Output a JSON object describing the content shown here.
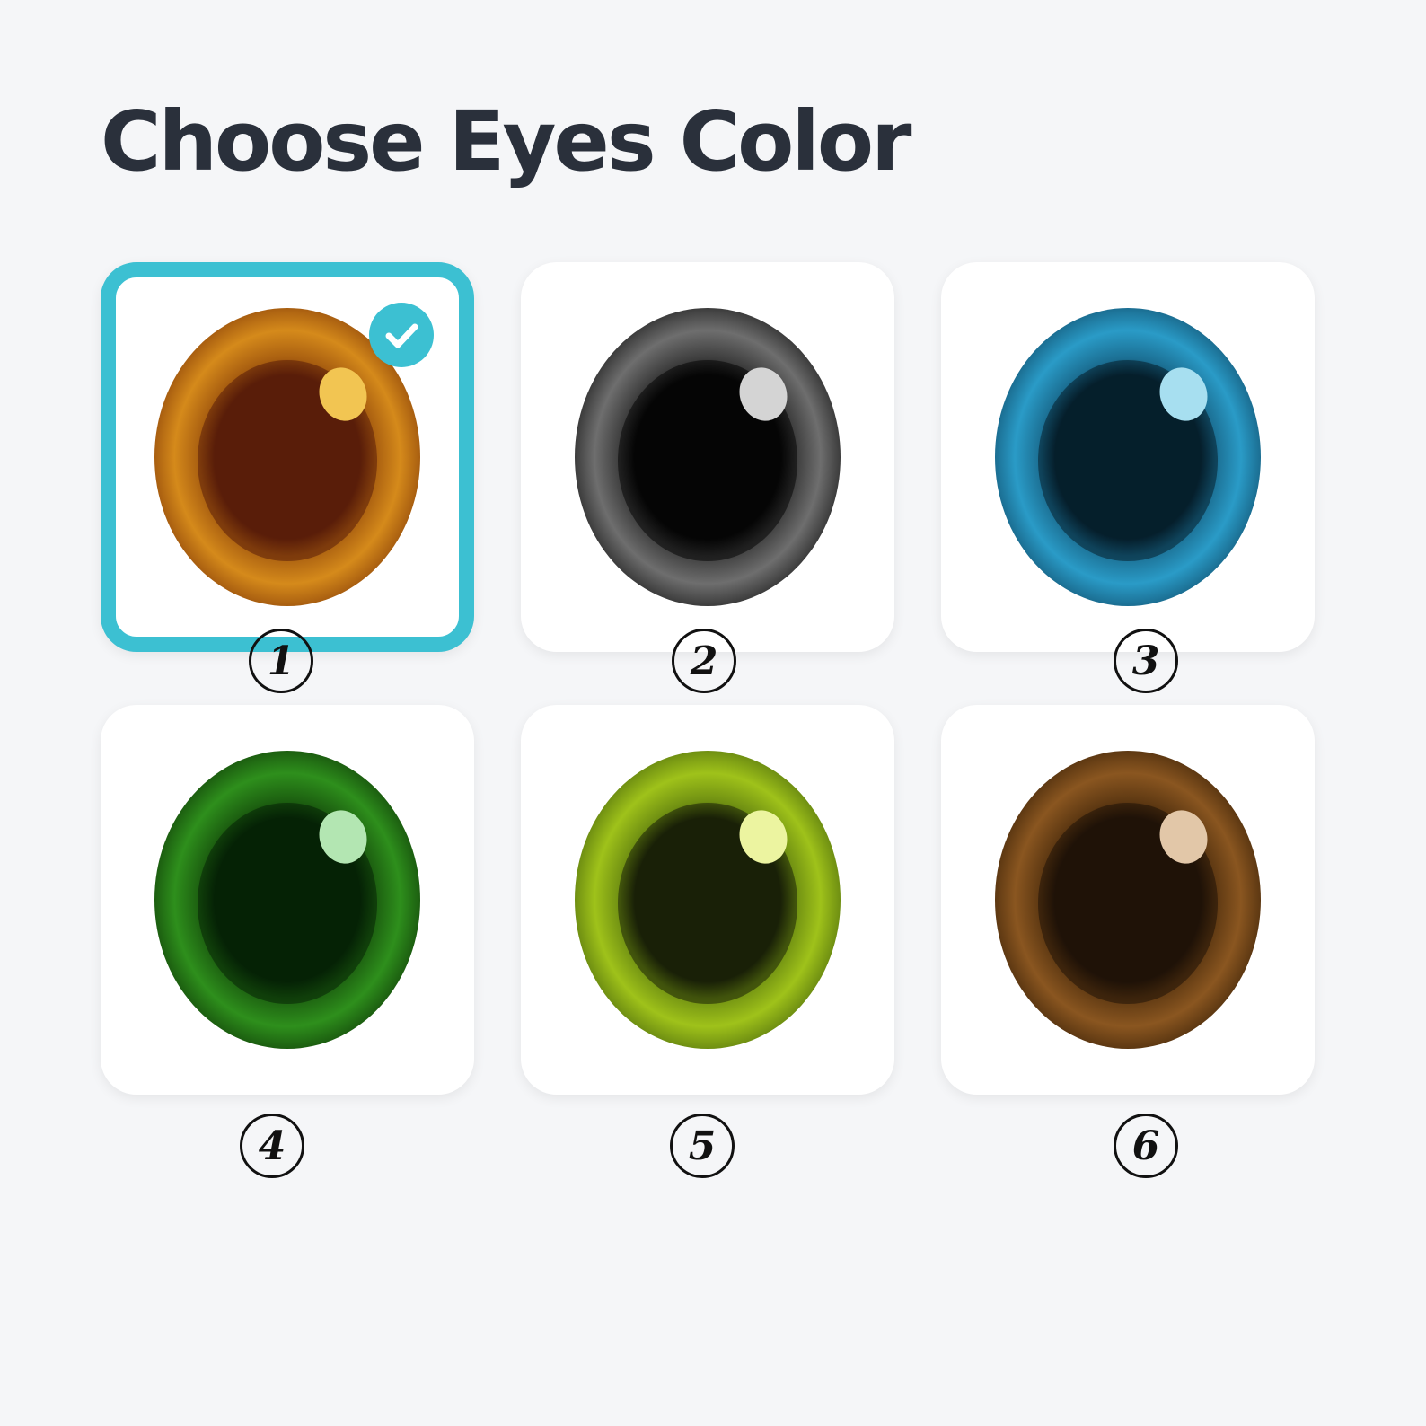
{
  "page": {
    "title": "Choose Eyes Color"
  },
  "options": [
    {
      "number": "1",
      "name": "amber-brown",
      "iris": "#d58a1b",
      "iris_dark": "#a85e10",
      "pupil": "#5a1e0a",
      "highlight": "#f2c552",
      "selected": true
    },
    {
      "number": "2",
      "name": "gray",
      "iris": "#6e6e6e",
      "iris_dark": "#3c3c3c",
      "pupil": "#050505",
      "highlight": "#d4d4d4",
      "selected": false
    },
    {
      "number": "3",
      "name": "blue",
      "iris": "#2a9bc7",
      "iris_dark": "#1b6e92",
      "pupil": "#061f2c",
      "highlight": "#a7dff0",
      "selected": false
    },
    {
      "number": "4",
      "name": "green",
      "iris": "#2e8f1c",
      "iris_dark": "#1c5e10",
      "pupil": "#062306",
      "highlight": "#b3e6b2",
      "selected": false
    },
    {
      "number": "5",
      "name": "lime",
      "iris": "#9fc21a",
      "iris_dark": "#6f8f12",
      "pupil": "#1a2108",
      "highlight": "#ecf4a0",
      "selected": false
    },
    {
      "number": "6",
      "name": "brown",
      "iris": "#8a5620",
      "iris_dark": "#5d3812",
      "pupil": "#1f1208",
      "highlight": "#e2c7a8",
      "selected": false
    }
  ],
  "check_icon": "check-icon"
}
